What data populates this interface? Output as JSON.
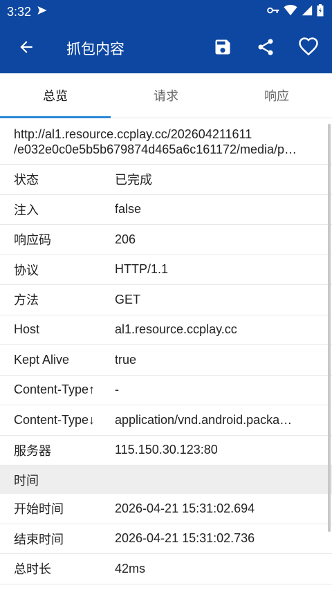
{
  "status_bar": {
    "time": "3:32",
    "icons": [
      "send-icon",
      "vpn-key-icon",
      "wifi-icon",
      "signal-icon",
      "battery-icon"
    ]
  },
  "appbar": {
    "title": "抓包内容",
    "icons": [
      "back-arrow-icon",
      "save-icon",
      "share-icon",
      "heart-icon"
    ],
    "color": "#0d47a1"
  },
  "tabs": [
    {
      "label": "总览",
      "active": true
    },
    {
      "label": "请求",
      "active": false
    },
    {
      "label": "响应",
      "active": false
    }
  ],
  "url": {
    "line1": "http://al1.resource.ccplay.cc/202604211611",
    "line2": "/e032e0c0e5b5b679874d465a6c161172/media/p…"
  },
  "rows": [
    {
      "key": "状态",
      "value": "已完成"
    },
    {
      "key": "注入",
      "value": "false"
    },
    {
      "key": "响应码",
      "value": "206"
    },
    {
      "key": "协议",
      "value": "HTTP/1.1"
    },
    {
      "key": "方法",
      "value": "GET"
    },
    {
      "key": "Host",
      "value": "al1.resource.ccplay.cc"
    },
    {
      "key": "Kept Alive",
      "value": "true"
    },
    {
      "key": "Content-Type↑",
      "value": "-"
    },
    {
      "key": "Content-Type↓",
      "value": "application/vnd.android.packa…"
    },
    {
      "key": "服务器",
      "value": "115.150.30.123:80"
    }
  ],
  "time_section": {
    "title": "时间",
    "rows": [
      {
        "key": "开始时间",
        "value": "2026-04-21 15:31:02.694"
      },
      {
        "key": "结束时间",
        "value": "2026-04-21 15:31:02.736"
      },
      {
        "key": "总时长",
        "value": "42ms"
      }
    ]
  }
}
